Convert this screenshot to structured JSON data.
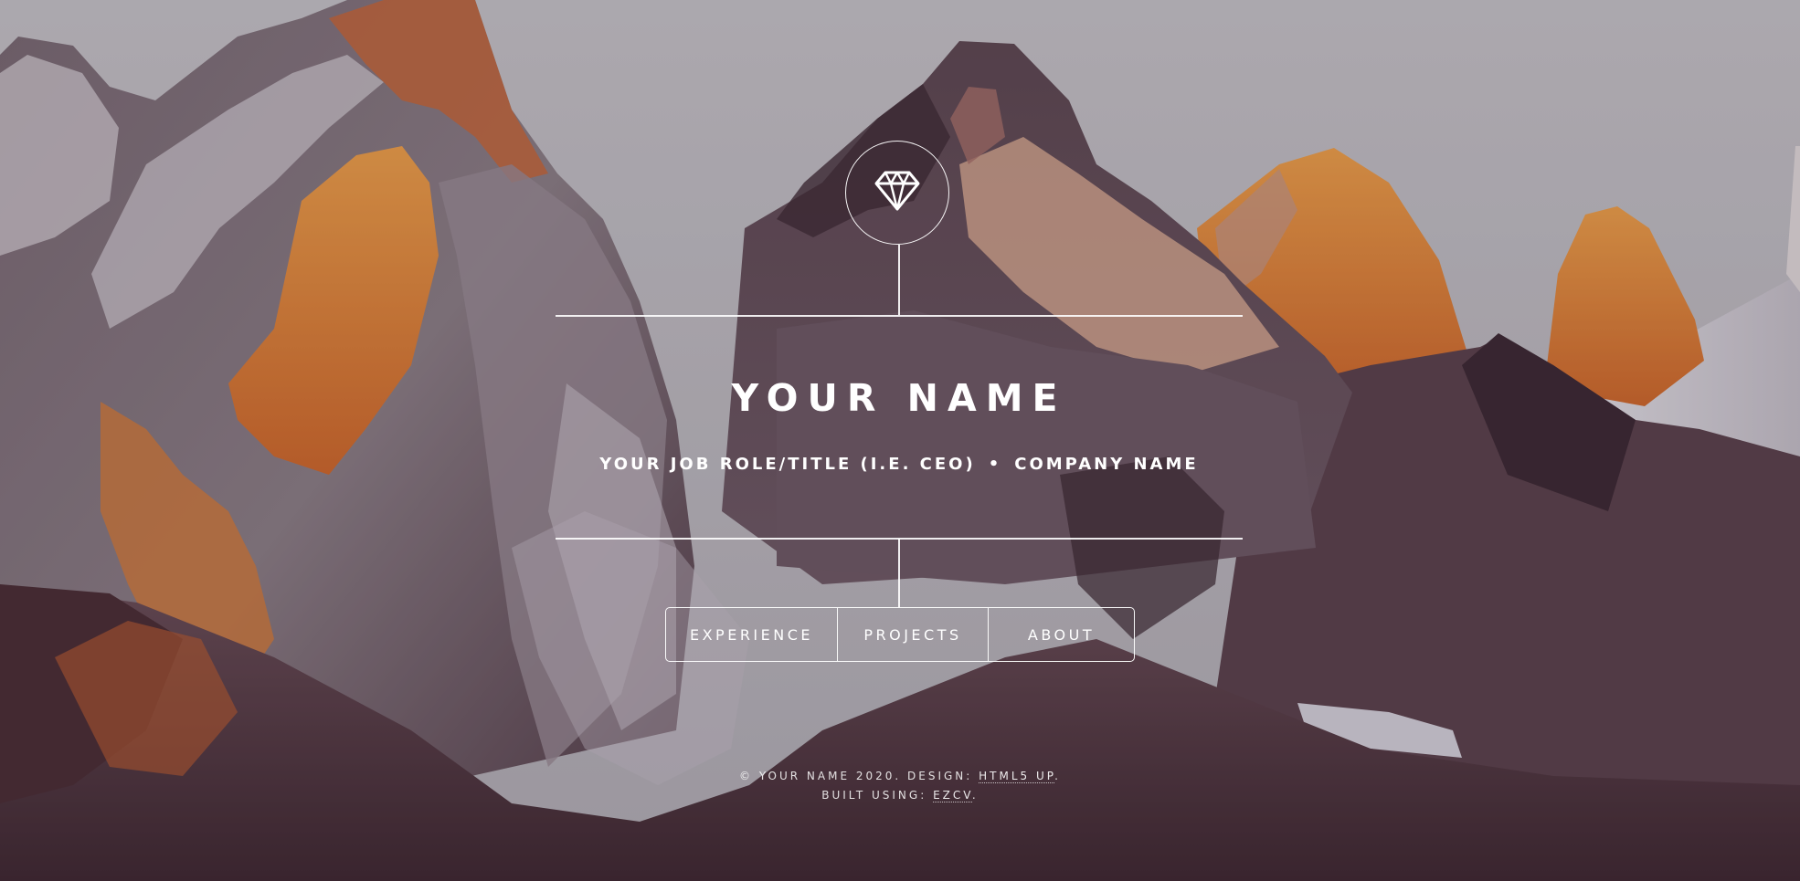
{
  "header": {
    "logo_icon": "gem-icon",
    "name": "YOUR NAME",
    "job_title": "YOUR JOB ROLE/TITLE (I.E. CEO)",
    "separator": "•",
    "company": "COMPANY NAME"
  },
  "nav": {
    "items": [
      {
        "label": "EXPERIENCE"
      },
      {
        "label": "PROJECTS"
      },
      {
        "label": "ABOUT"
      }
    ]
  },
  "footer": {
    "copyright": "© YOUR NAME 2020. DESIGN:",
    "design_link": "HTML5 UP",
    "design_end": ".",
    "built_prefix": "BUILT USING:",
    "built_link": "EZCV",
    "built_end": "."
  },
  "colors": {
    "sky": "#c6c4ca",
    "rock_dark": "#4a3440",
    "alpenglow": "#f08a2a",
    "text": "#ffffff"
  }
}
